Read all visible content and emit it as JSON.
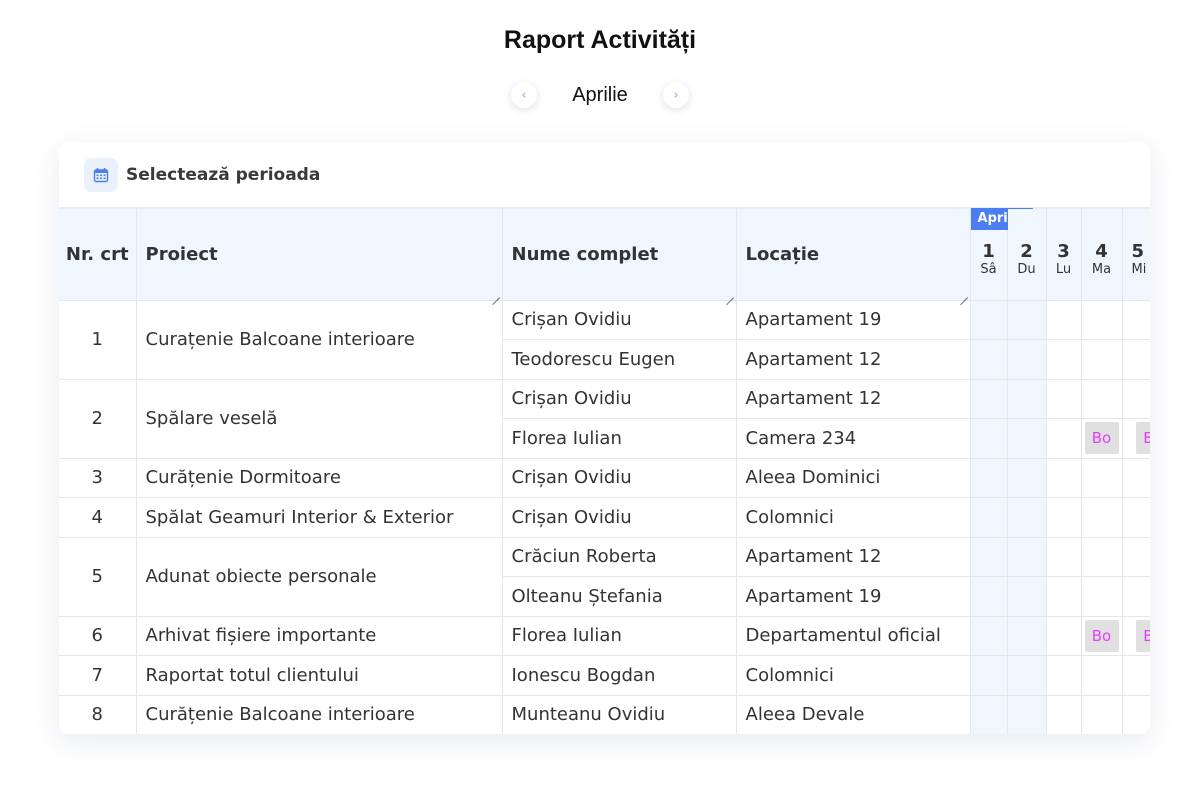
{
  "header": {
    "title": "Raport Activități"
  },
  "month_nav": {
    "prev_icon": "‹",
    "next_icon": "›",
    "month": "Aprilie"
  },
  "toolbar": {
    "select_period_label": "Selectează perioada",
    "icon": "calendar-icon"
  },
  "table": {
    "columns": {
      "nr": "Nr. crt",
      "project": "Proiect",
      "name": "Nume complet",
      "location": "Locație"
    },
    "month_tag": "Aprilie",
    "days": [
      {
        "num": "1",
        "name": "Sâ",
        "weekend": true
      },
      {
        "num": "2",
        "name": "Du",
        "weekend": true
      },
      {
        "num": "3",
        "name": "Lu",
        "weekend": false
      },
      {
        "num": "4",
        "name": "Ma",
        "weekend": false
      },
      {
        "num": "5",
        "name": "Mi",
        "weekend": false
      }
    ],
    "groups": [
      {
        "nr": "1",
        "project": "Curațenie Balcoane interioare",
        "rows": [
          {
            "name": "Crișan Ovidiu",
            "location": "Apartament 19",
            "cells": [
              "",
              "",
              "",
              "",
              ""
            ]
          },
          {
            "name": "Teodorescu Eugen",
            "location": "Apartament 12",
            "cells": [
              "",
              "",
              "",
              "",
              ""
            ]
          }
        ]
      },
      {
        "nr": "2",
        "project": "Spălare veselă",
        "rows": [
          {
            "name": "Crișan Ovidiu",
            "location": "Apartament 12",
            "cells": [
              "",
              "",
              "",
              "",
              ""
            ]
          },
          {
            "name": "Florea Iulian",
            "location": "Camera 234",
            "cells": [
              "",
              "",
              "",
              "Bo",
              "Bo"
            ]
          }
        ]
      },
      {
        "nr": "3",
        "project": "Curățenie Dormitoare",
        "rows": [
          {
            "name": "Crișan Ovidiu",
            "location": "Aleea Dominici",
            "cells": [
              "",
              "",
              "",
              "",
              ""
            ]
          }
        ]
      },
      {
        "nr": "4",
        "project": "Spălat Geamuri Interior & Exterior",
        "rows": [
          {
            "name": "Crișan Ovidiu",
            "location": "Colomnici",
            "cells": [
              "",
              "",
              "",
              "",
              ""
            ]
          }
        ]
      },
      {
        "nr": "5",
        "project": "Adunat obiecte personale",
        "rows": [
          {
            "name": "Crăciun Roberta",
            "location": "Apartament 12",
            "cells": [
              "",
              "",
              "",
              "",
              ""
            ]
          },
          {
            "name": "Olteanu Ștefania",
            "location": "Apartament 19",
            "cells": [
              "",
              "",
              "",
              "",
              ""
            ]
          }
        ]
      },
      {
        "nr": "6",
        "project": "Arhivat fișiere importante",
        "rows": [
          {
            "name": "Florea Iulian",
            "location": "Departamentul oficial",
            "cells": [
              "",
              "",
              "",
              "Bo",
              "Bo"
            ]
          }
        ]
      },
      {
        "nr": "7",
        "project": "Raportat totul clientului",
        "rows": [
          {
            "name": "Ionescu Bogdan",
            "location": "Colomnici",
            "cells": [
              "",
              "",
              "",
              "",
              ""
            ]
          }
        ]
      },
      {
        "nr": "8",
        "project": "Curățenie Balcoane interioare",
        "rows": [
          {
            "name": "Munteanu Ovidiu",
            "location": "Aleea Devale",
            "cells": [
              "",
              "",
              "",
              "",
              ""
            ]
          }
        ]
      }
    ]
  }
}
